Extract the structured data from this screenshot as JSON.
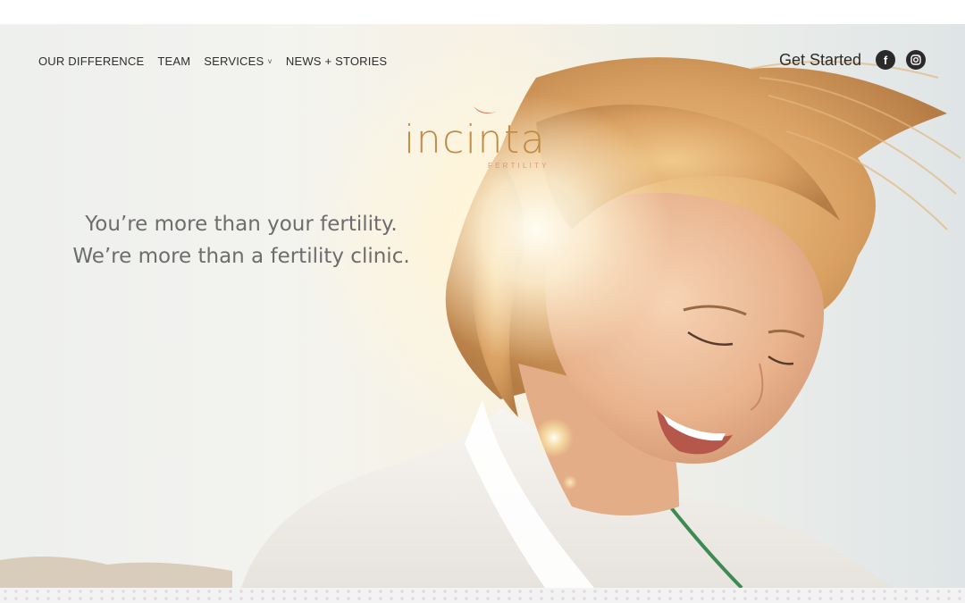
{
  "nav": {
    "items": [
      {
        "label": "OUR DIFFERENCE"
      },
      {
        "label": "TEAM"
      },
      {
        "label": "SERVICES",
        "has_dropdown": true,
        "chevron": "˅"
      },
      {
        "label": "NEWS + STORIES"
      }
    ],
    "get_started": "Get Started",
    "social": [
      {
        "icon": "facebook-icon",
        "glyph": "f"
      },
      {
        "icon": "instagram-icon"
      }
    ]
  },
  "logo": {
    "word": "incinta",
    "sub": "FERTILITY",
    "color": "#c08a45",
    "accent_color": "#e07a62"
  },
  "hero": {
    "line1": "You’re more than your fertility.",
    "line2": "We’re more than a fertility clinic.",
    "image": "smiling-woman-sunlight-photo"
  },
  "colors": {
    "text_dark": "#2c2b2b",
    "tagline": "#6e6c6c"
  }
}
